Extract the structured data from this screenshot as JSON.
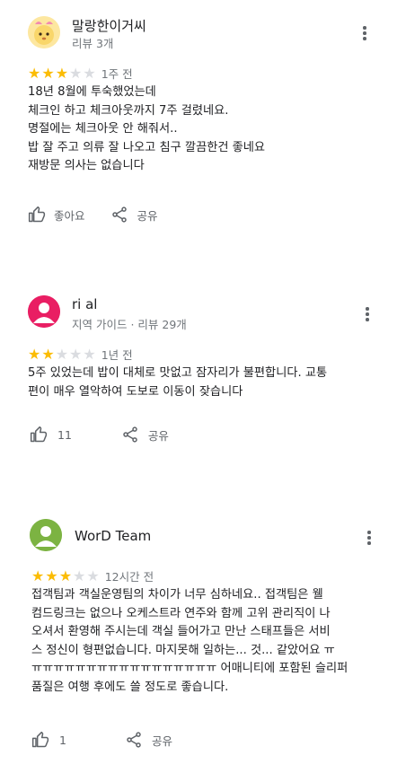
{
  "reviews": [
    {
      "name": "말랑한이거씨",
      "meta": "리뷰 3개",
      "stars": 3,
      "time": "1주 전",
      "body_lines": [
        "18년 8월에 투숙했었는데",
        "체크인 하고 체크아웃까지 7주 걸렸네요.",
        "명절에는 체크아웃 안 해줘서..",
        "밥 잘 주고 의류 잘 나오고 침구 깔끔한건 좋네요",
        "재방문 의사는 없습니다"
      ],
      "like_label": "좋아요",
      "share_label": "공유",
      "avatar": "yellow-cartoon-face"
    },
    {
      "name": "ri al",
      "meta": "지역 가이드 · 리뷰 29개",
      "stars": 2,
      "time": "1년 전",
      "body_lines": [
        "5주 있었는데 밥이 대체로 맛없고 잠자리가 불편합니다. 교통",
        "편이 매우 열악하여 도보로 이동이 잦습니다"
      ],
      "like_label": "11",
      "share_label": "공유",
      "avatar_color": "#e91e63"
    },
    {
      "name": "WorD Team",
      "meta": "",
      "stars": 3,
      "time": "12시간 전",
      "body_lines": [
        "접객팀과 객실운영팀의 차이가 너무 심하네요.. 접객팀은 웰",
        "컴드링크는 없으나 오케스트라 연주와 함께 고위 관리직이 나",
        "오셔서 환영해 주시는데 객실 들어가고 만난 스태프들은 서비",
        "스 정신이 형편없습니다. 마지못해 일하는... 것... 같았어요 ㅠ",
        "ㅠㅠㅠㅠㅠㅠㅠㅠㅠㅠㅠㅠㅠㅠㅠㅠㅠ 어매니티에 포함된 슬리퍼",
        "품질은 여행 후에도 쓸 정도로 좋습니다."
      ],
      "like_label": "1",
      "share_label": "공유",
      "avatar_color": "#7cb342"
    }
  ],
  "icons": {
    "like": "thumb-up-icon",
    "share": "share-icon",
    "more": "more-vert-icon",
    "star": "star-icon"
  },
  "colors": {
    "star_on": "#fbbc04",
    "star_off": "#dadce0",
    "secondary_text": "#70757a"
  }
}
